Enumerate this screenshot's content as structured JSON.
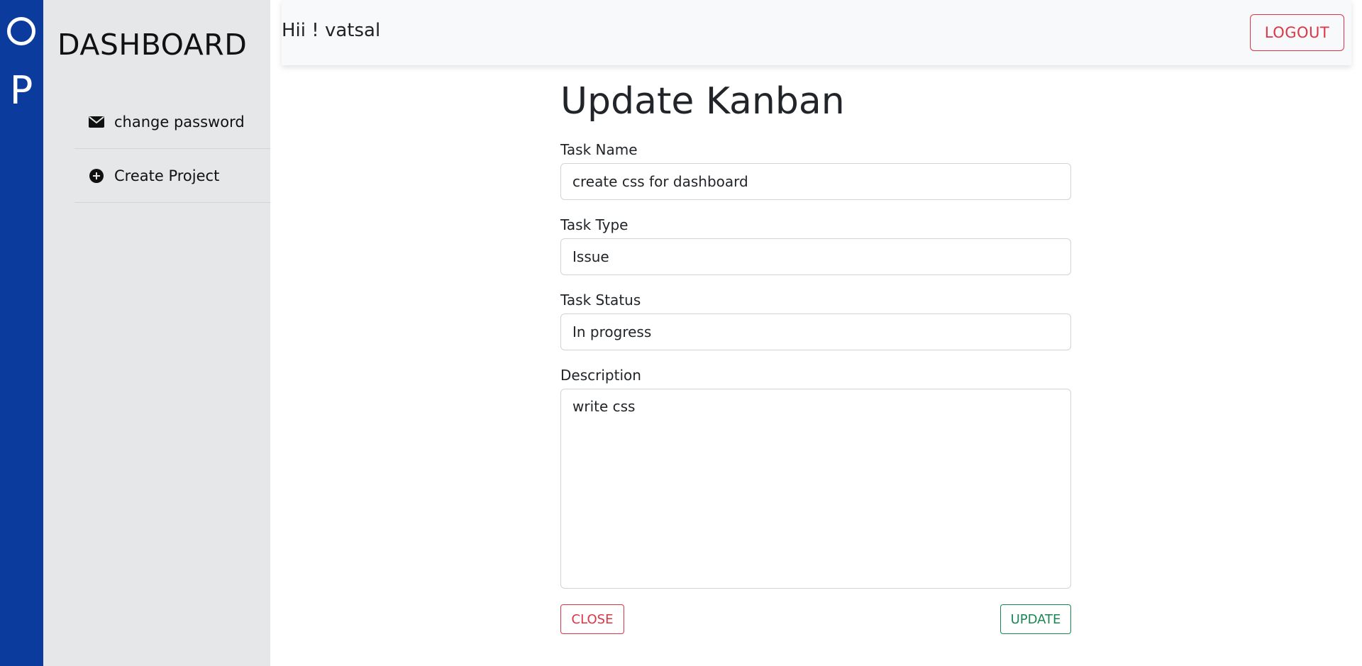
{
  "brand": {
    "logo_letter_1": "O",
    "logo_letter_2": "P",
    "rail_color": "#0b3b9c"
  },
  "sidebar": {
    "title": "DASHBOARD",
    "items": [
      {
        "label": "change password",
        "icon": "envelope-icon"
      },
      {
        "label": "Create Project",
        "icon": "plus-circle-icon"
      }
    ]
  },
  "header": {
    "greeting": "Hii ! vatsal",
    "logout_label": "LOGOUT"
  },
  "form": {
    "title": "Update Kanban",
    "task_name": {
      "label": "Task Name",
      "value": "create css for dashboard"
    },
    "task_type": {
      "label": "Task Type",
      "value": "Issue"
    },
    "task_status": {
      "label": "Task Status",
      "value": "In progress"
    },
    "description": {
      "label": "Description",
      "value": "write css"
    },
    "close_label": "CLOSE",
    "update_label": "UPDATE"
  },
  "colors": {
    "danger": "#dc3545",
    "success": "#198754",
    "sidebar_bg": "#e6e7e8"
  }
}
